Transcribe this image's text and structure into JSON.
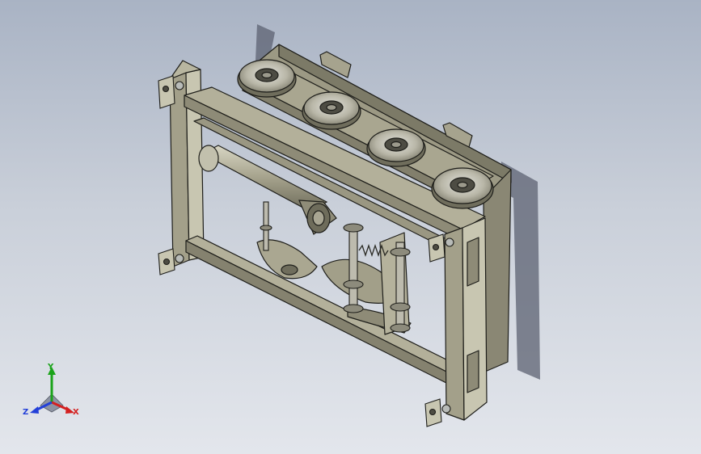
{
  "viewport": {
    "model": "mechanism-assembly",
    "colors": {
      "body": "#a3a08a",
      "body_dark": "#6f6d5c",
      "body_light": "#c8c6b1",
      "steel": "#b8bbb8",
      "edge": "#1e1e1a",
      "shadow": "#5c6272"
    }
  },
  "triad": {
    "x_label": "X",
    "y_label": "Y",
    "z_label": "Z",
    "colors": {
      "x": "#d42020",
      "y": "#1aa31a",
      "z": "#2340d8"
    }
  }
}
